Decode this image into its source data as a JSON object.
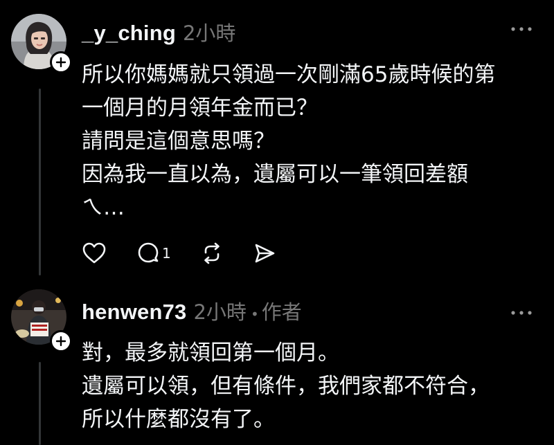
{
  "posts": [
    {
      "username": "_y_ching",
      "time": "2小時",
      "author_tag": "",
      "body_lines": [
        "所以你媽媽就只領過一次剛滿65歲時候的第",
        "一個月的月領年金而已？",
        "請問是這個意思嗎？",
        "因為我一直以為，遺屬可以一筆領回差額",
        "ㄟ…"
      ],
      "actions": {
        "like_icon": "heart-icon",
        "reply_icon": "comment-icon",
        "reply_count": "1",
        "repost_icon": "repost-icon",
        "share_icon": "send-icon"
      },
      "avatar_icon": "profile-photo"
    },
    {
      "username": "henwen73",
      "time": "2小時",
      "separator": "•",
      "author_tag": "作者",
      "body_lines": [
        "對，最多就領回第一個月。",
        "遺屬可以領，但有條件，我們家都不符合，",
        "所以什麼都沒有了。"
      ],
      "avatar_icon": "profile-photo"
    }
  ],
  "icons": {
    "more": "more-horizontal-icon",
    "follow": "plus-icon"
  },
  "colors": {
    "background": "#000000",
    "text_primary": "#f3f5f7",
    "text_secondary": "#777777",
    "thread_line": "#333638"
  }
}
